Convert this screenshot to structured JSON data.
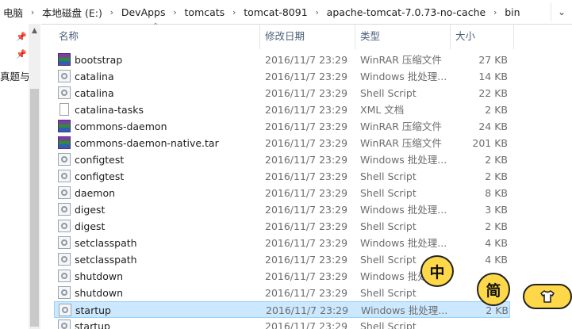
{
  "address_bar": {
    "crumbs": [
      "电脑",
      "本地磁盘 (E:)",
      "DevApps",
      "tomcats",
      "tomcat-8091",
      "apache-tomcat-7.0.73-no-cache",
      "bin"
    ],
    "dropdown_icon": "chevron-down-icon"
  },
  "nav_pane": {
    "partial_label": "真题与"
  },
  "columns": {
    "name": "名称",
    "date": "修改日期",
    "type": "类型",
    "size": "大小"
  },
  "files": [
    {
      "name": "bootstrap",
      "date": "2016/11/7 23:29",
      "type": "WinRAR 压缩文件",
      "size": "27 KB",
      "icon": "rar"
    },
    {
      "name": "catalina",
      "date": "2016/11/7 23:29",
      "type": "Windows 批处理...",
      "size": "14 KB",
      "icon": "bat"
    },
    {
      "name": "catalina",
      "date": "2016/11/7 23:29",
      "type": "Shell Script",
      "size": "22 KB",
      "icon": "bat"
    },
    {
      "name": "catalina-tasks",
      "date": "2016/11/7 23:29",
      "type": "XML 文档",
      "size": "2 KB",
      "icon": "doc"
    },
    {
      "name": "commons-daemon",
      "date": "2016/11/7 23:29",
      "type": "WinRAR 压缩文件",
      "size": "24 KB",
      "icon": "rar"
    },
    {
      "name": "commons-daemon-native.tar",
      "date": "2016/11/7 23:29",
      "type": "WinRAR 压缩文件",
      "size": "201 KB",
      "icon": "rar"
    },
    {
      "name": "configtest",
      "date": "2016/11/7 23:29",
      "type": "Windows 批处理...",
      "size": "2 KB",
      "icon": "bat"
    },
    {
      "name": "configtest",
      "date": "2016/11/7 23:29",
      "type": "Shell Script",
      "size": "2 KB",
      "icon": "bat"
    },
    {
      "name": "daemon",
      "date": "2016/11/7 23:29",
      "type": "Shell Script",
      "size": "8 KB",
      "icon": "bat"
    },
    {
      "name": "digest",
      "date": "2016/11/7 23:29",
      "type": "Windows 批处理...",
      "size": "3 KB",
      "icon": "bat"
    },
    {
      "name": "digest",
      "date": "2016/11/7 23:29",
      "type": "Shell Script",
      "size": "2 KB",
      "icon": "bat"
    },
    {
      "name": "setclasspath",
      "date": "2016/11/7 23:29",
      "type": "Windows 批处理...",
      "size": "4 KB",
      "icon": "bat"
    },
    {
      "name": "setclasspath",
      "date": "2016/11/7 23:29",
      "type": "Shell Script",
      "size": "4 KB",
      "icon": "bat"
    },
    {
      "name": "shutdown",
      "date": "2016/11/7 23:29",
      "type": "Windows 批处",
      "size": "",
      "icon": "bat"
    },
    {
      "name": "shutdown",
      "date": "2016/11/7 23:29",
      "type": "Shell Script",
      "size": "",
      "icon": "bat"
    },
    {
      "name": "startup",
      "date": "2016/11/7 23:29",
      "type": "Windows 批处理...",
      "size": "2 KB",
      "icon": "bat",
      "selected": true
    },
    {
      "name": "startup",
      "date": "2016/11/7 23:29",
      "type": "Shell Script",
      "size": "",
      "icon": "bat"
    }
  ],
  "widgets": {
    "zhong": "中",
    "jian": "简",
    "shirt_icon": "shirt-icon"
  }
}
